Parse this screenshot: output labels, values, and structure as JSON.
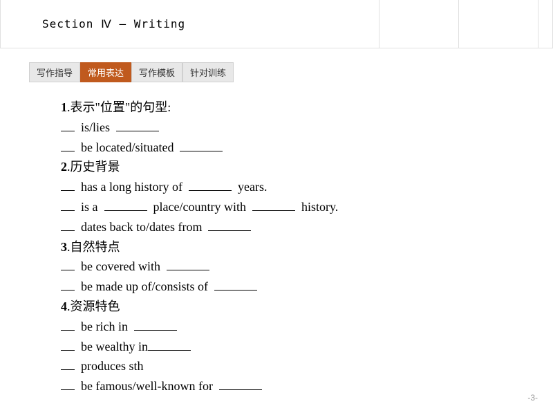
{
  "header": {
    "title": "Section Ⅳ — Writing"
  },
  "tabs": [
    {
      "label": "写作指导",
      "active": false
    },
    {
      "label": "常用表达",
      "active": true
    },
    {
      "label": "写作模板",
      "active": false
    },
    {
      "label": "针对训练",
      "active": false
    }
  ],
  "sections": [
    {
      "num": "1",
      "title": ".表示\"位置\"的句型:",
      "items": [
        {
          "text_before": "is/lies",
          "text_after": ""
        },
        {
          "text_before": "be located/situated",
          "text_after": ""
        }
      ]
    },
    {
      "num": "2",
      "title": ".历史背景",
      "items": [
        {
          "text_before": "has a long history of",
          "text_mid": "",
          "text_after": "years."
        },
        {
          "text_before": "is a",
          "text_mid": "place/country with",
          "text_after": "history."
        },
        {
          "text_before": "dates back to/dates from",
          "text_after": ""
        }
      ]
    },
    {
      "num": "3",
      "title": ".自然特点",
      "items": [
        {
          "text_before": "be covered with",
          "text_after": ""
        },
        {
          "text_before": "be made up of/consists of",
          "text_after": ""
        }
      ]
    },
    {
      "num": "4",
      "title": ".资源特色",
      "items": [
        {
          "text_before": "be rich in",
          "text_after": ""
        },
        {
          "text_before": "be wealthy in",
          "text_after": "",
          "no_space": true
        },
        {
          "text_before": "produces sth",
          "text_after": "",
          "no_blank_after": true
        },
        {
          "text_before": "be famous/well-known for",
          "text_after": ""
        }
      ]
    }
  ],
  "page_number": "-3-"
}
